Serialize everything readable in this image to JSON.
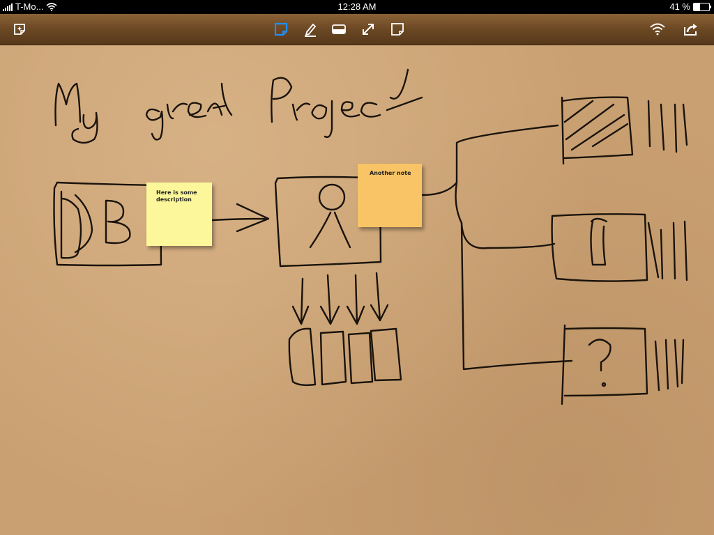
{
  "status_bar": {
    "carrier": "T-Mo...",
    "time": "12:28 AM",
    "battery_percent": "41 %",
    "battery_level": 0.41,
    "signal_icon": "signal-bars-icon",
    "wifi_icon": "wifi-icon"
  },
  "toolbar": {
    "left": [
      {
        "name": "new-page-button",
        "icon": "new-note-icon"
      }
    ],
    "center": [
      {
        "name": "note-tool-button",
        "icon": "sticky-note-icon",
        "active": true
      },
      {
        "name": "pen-tool-button",
        "icon": "pencil-icon"
      },
      {
        "name": "eraser-tool-button",
        "icon": "eraser-icon"
      },
      {
        "name": "move-tool-button",
        "icon": "resize-arrows-icon"
      },
      {
        "name": "text-note-button",
        "icon": "note-icon"
      }
    ],
    "right": [
      {
        "name": "wifi-share-button",
        "icon": "wifi-icon"
      },
      {
        "name": "export-button",
        "icon": "share-icon"
      }
    ]
  },
  "canvas": {
    "notes": [
      {
        "text": "Here is some description",
        "color": "#fbf79a"
      },
      {
        "text": "Another note",
        "color": "#f8c465"
      }
    ],
    "ink_color": "#1a130c",
    "accent_color": "#1e90ff"
  }
}
